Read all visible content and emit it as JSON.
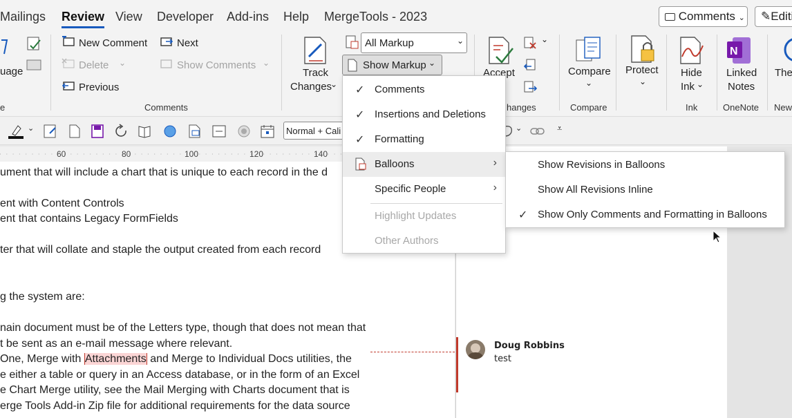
{
  "tabs": [
    "Mailings",
    "Review",
    "View",
    "Developer",
    "Add-ins",
    "Help",
    "MergeTools - 2023"
  ],
  "top_buttons": {
    "comments": "Comments",
    "editing": "Editi"
  },
  "ribbon": {
    "language_partial": "uage",
    "comments": {
      "new": "New Comment",
      "delete": "Delete",
      "previous": "Previous",
      "next": "Next",
      "show": "Show Comments",
      "group": "Comments"
    },
    "tracking": {
      "markup_select": "All Markup",
      "show_markup": "Show Markup",
      "track_line1": "Track",
      "track_line2": "Changes"
    },
    "changes": {
      "accept": "Accept",
      "group_partial": "hanges"
    },
    "compare": {
      "label": "Compare",
      "group": "Compare"
    },
    "protect": {
      "label": "Protect"
    },
    "ink": {
      "line1": "Hide",
      "line2": "Ink",
      "group": "Ink"
    },
    "onenote": {
      "line1": "Linked",
      "line2": "Notes",
      "group": "OneNote"
    },
    "new_partial": {
      "label": "The",
      "group": "New"
    },
    "style_select": "Normal + Cali"
  },
  "ruler": [
    "60",
    "80",
    "100",
    "120",
    "140"
  ],
  "document": {
    "lines": [
      "ument that will include a chart that is unique to each record in the d",
      "ent with Content Controls",
      "ent that contains Legacy FormFields",
      "ter that will collate and staple the output created from each record",
      "g the system are:",
      "nain document must be of the Letters type, though that does not mean that",
      "t be sent as an e-mail message where relevant.",
      "e either a table or query in an Access database, or in the form of an Excel",
      "e Chart Merge utility, see the Mail Merging with Charts document that is",
      "erge Tools Add-in Zip file for additional requirements for the data source"
    ],
    "commented_line": {
      "before": "One, Merge with ",
      "highlight": "Attachments",
      "after": " and Merge to Individual Docs utilities, the"
    }
  },
  "comment": {
    "author": "Doug Robbins",
    "text": "test"
  },
  "show_markup_menu": [
    {
      "label": "Comments",
      "checked": true
    },
    {
      "label": "Insertions and Deletions",
      "checked": true
    },
    {
      "label": "Formatting",
      "checked": true
    },
    {
      "label": "Balloons",
      "submenu": true
    },
    {
      "label": "Specific People",
      "submenu": true
    },
    {
      "label": "Highlight Updates",
      "disabled": true
    },
    {
      "label": "Other Authors",
      "disabled": true
    }
  ],
  "balloons_menu": [
    {
      "label": "Show Revisions in Balloons"
    },
    {
      "label": "Show All Revisions Inline"
    },
    {
      "label": "Show Only Comments and Formatting in Balloons",
      "checked": true
    }
  ],
  "colors": {
    "accent": "#185abd",
    "revision_bar": "#c0392b",
    "highlight": "#fbd5d5"
  }
}
